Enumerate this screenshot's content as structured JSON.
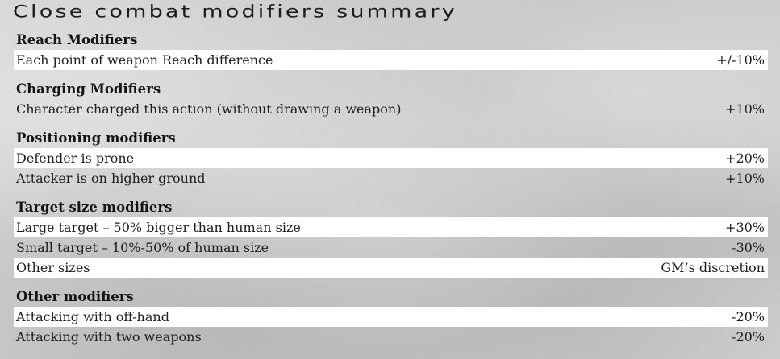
{
  "title": "Close combat modifiers summary",
  "sections": [
    {
      "heading": "Reach Modifiers",
      "rows": [
        {
          "label": "Each point of weapon Reach difference",
          "value": "+/-10%"
        }
      ]
    },
    {
      "heading": "Charging Modifiers",
      "rows": [
        {
          "label": "Character charged this action (without drawing a weapon)",
          "value": "+10%"
        }
      ]
    },
    {
      "heading": "Positioning modifiers",
      "rows": [
        {
          "label": "Defender is prone",
          "value": "+20%"
        },
        {
          "label": "Attacker is on higher ground",
          "value": "+10%"
        }
      ]
    },
    {
      "heading": "Target size modifiers",
      "rows": [
        {
          "label": "Large target – 50% bigger than human size",
          "value": "+30%"
        },
        {
          "label": "Small target – 10%-50% of human size",
          "value": "-30%"
        },
        {
          "label": "Other sizes",
          "value": "GM’s discretion"
        }
      ]
    },
    {
      "heading": "Other modifiers",
      "rows": [
        {
          "label": "Attacking with off-hand",
          "value": "-20%"
        },
        {
          "label": "Attacking with two weapons",
          "value": "-20%"
        }
      ]
    }
  ]
}
